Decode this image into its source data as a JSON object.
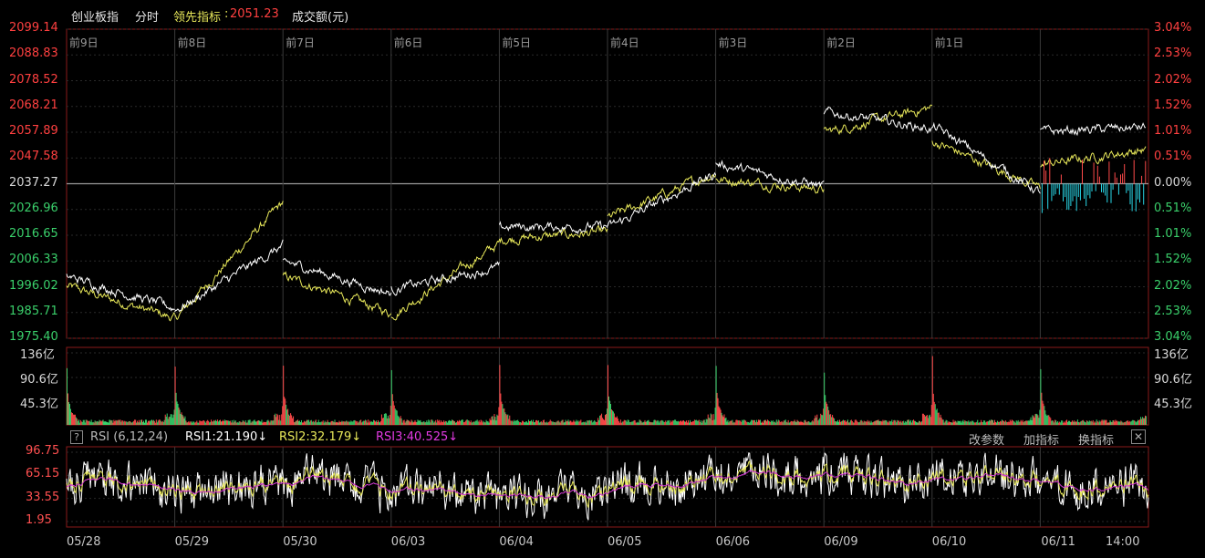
{
  "header": {
    "instrument": "创业板指",
    "mode": "分时",
    "leading_label": "领先指标",
    "leading_sep": ":",
    "leading_value": "2051.23",
    "volume_label": "成交额(元)"
  },
  "price_axis": {
    "left_labels": [
      "2099.14",
      "2088.83",
      "2078.52",
      "2068.21",
      "2057.89",
      "2047.58",
      "2037.27",
      "2026.96",
      "2016.65",
      "2006.33",
      "1996.02",
      "1985.71",
      "1975.40"
    ],
    "right_labels": [
      "3.04%",
      "2.53%",
      "2.02%",
      "1.52%",
      "1.01%",
      "0.51%",
      "0.00%",
      "0.51%",
      "1.01%",
      "1.52%",
      "2.02%",
      "2.53%",
      "3.04%"
    ],
    "colors": {
      "up": "#ff4040",
      "flat": "#d8d8d8",
      "down": "#3ad06b"
    }
  },
  "day_labels": [
    "前9日",
    "前8日",
    "前7日",
    "前6日",
    "前5日",
    "前4日",
    "前3日",
    "前2日",
    "前1日"
  ],
  "volume_axis": {
    "labels": [
      "136亿",
      "90.6亿",
      "45.3亿"
    ]
  },
  "rsi": {
    "title": "RSI (6,12,24)",
    "help": "?",
    "rsi1": "RSI1:21.190↓",
    "rsi2": "RSI2:32.179↓",
    "rsi3": "RSI3:40.525↓",
    "buttons": [
      "改参数",
      "加指标",
      "换指标"
    ],
    "close": "✕",
    "axis_labels": [
      "96.75",
      "65.15",
      "33.55",
      "1.95"
    ]
  },
  "date_labels": [
    "05/28",
    "05/29",
    "05/30",
    "06/03",
    "06/04",
    "06/05",
    "06/06",
    "06/09",
    "06/10",
    "06/11",
    "14:00"
  ],
  "colors": {
    "price": "#ffffff",
    "leading": "#e8e85a",
    "vol_up": "#ff4a4a",
    "vol_down": "#3ad06b",
    "rsi1": "#ffffff",
    "rsi2": "#e8e85a",
    "rsi3": "#d23ad2",
    "grid": "#2a2a2a",
    "axis": "#8a1a1a"
  },
  "chart_data": [
    {
      "type": "line",
      "title": "创业板指 分时",
      "y_range": [
        1975.4,
        2099.14
      ],
      "base_value": 2037.27,
      "x": [
        "前9日",
        "前8日",
        "前7日",
        "前6日",
        "前5日",
        "前4日",
        "前3日",
        "前2日",
        "前1日",
        "06/11"
      ],
      "series": [
        {
          "name": "创业板指",
          "values_start_end": [
            [
              2000,
              1987
            ],
            [
              1987,
              2013
            ],
            [
              2006,
              1993
            ],
            [
              1995,
              2004
            ],
            [
              2020,
              2020
            ],
            [
              2020,
              2042
            ],
            [
              2045,
              2036
            ],
            [
              2066,
              2059
            ],
            [
              2060,
              2033
            ],
            [
              2058,
              2060
            ]
          ]
        },
        {
          "name": "领先指标",
          "values_start_end": [
            [
              1996,
              1983
            ],
            [
              1984,
              2031
            ],
            [
              2000,
              1985
            ],
            [
              1985,
              2014
            ],
            [
              2015,
              2018
            ],
            [
              2024,
              2042
            ],
            [
              2039,
              2035
            ],
            [
              2058,
              2068
            ],
            [
              2054,
              2035
            ],
            [
              2045,
              2051.23
            ]
          ]
        }
      ]
    },
    {
      "type": "bar",
      "title": "成交额(元)",
      "y_range": [
        0,
        136
      ],
      "unit": "亿",
      "note": "each day opens with a spike near 90–136亿, decaying to ~5亿, with a smaller rise at the close"
    },
    {
      "type": "line",
      "title": "RSI (6,12,24)",
      "y_range": [
        1.95,
        96.75
      ],
      "series": [
        {
          "name": "RSI1",
          "last": 21.19
        },
        {
          "name": "RSI2",
          "last": 32.179
        },
        {
          "name": "RSI3",
          "last": 40.525
        }
      ]
    }
  ]
}
